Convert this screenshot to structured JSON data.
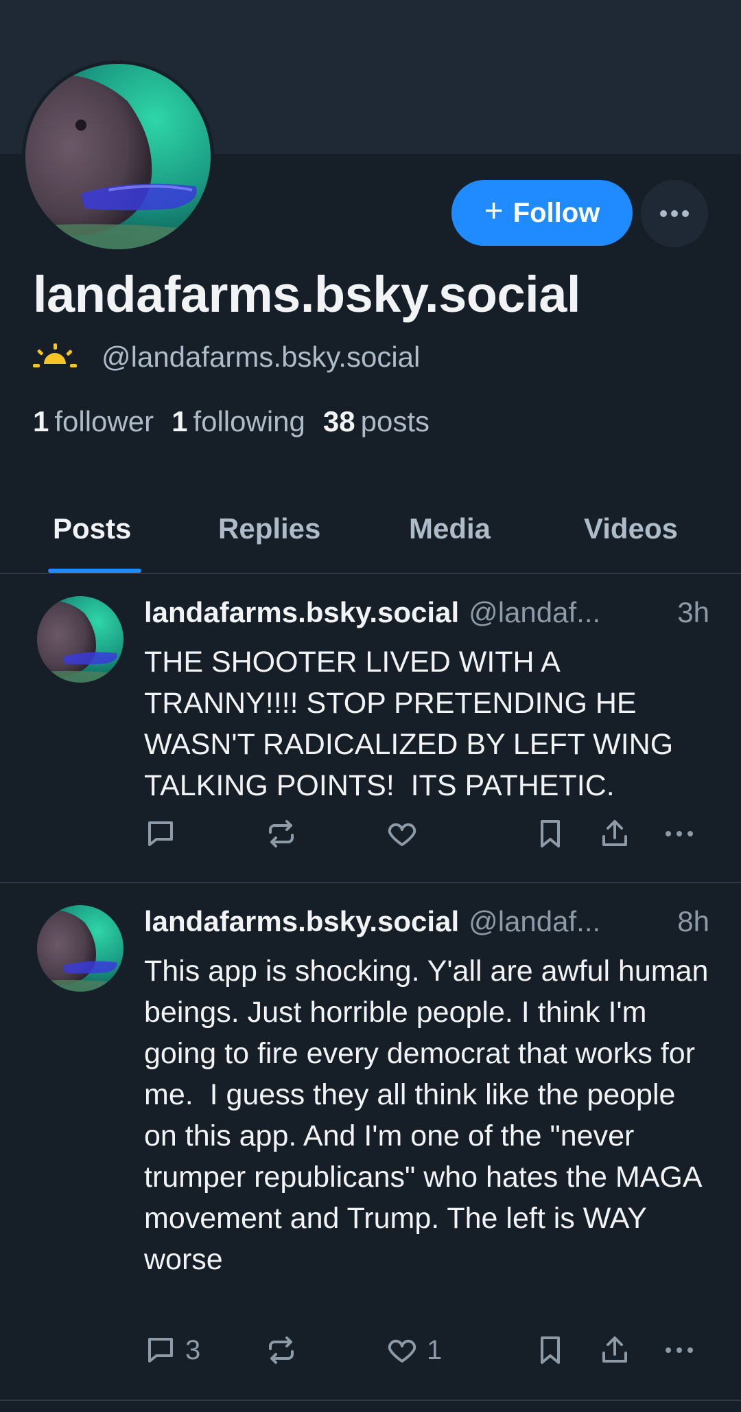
{
  "profile": {
    "display_name": "landafarms.bsky.social",
    "handle": "@landafarms.bsky.social",
    "status_icon": "sun-horizon-icon",
    "accent_color": "#208bfe"
  },
  "actions": {
    "follow_label": "Follow",
    "more_icon": "ellipsis-icon"
  },
  "stats": {
    "followers_count": "1",
    "followers_label": "follower",
    "following_count": "1",
    "following_label": "following",
    "posts_count": "38",
    "posts_label": "posts"
  },
  "tabs": [
    {
      "label": "Posts",
      "active": true
    },
    {
      "label": "Replies",
      "active": false
    },
    {
      "label": "Media",
      "active": false
    },
    {
      "label": "Videos",
      "active": false
    }
  ],
  "posts": [
    {
      "author": "landafarms.bsky.social",
      "handle": "@landaf...",
      "time": "3h",
      "text": "THE SHOOTER LIVED WITH A TRANNY!!!! STOP PRETENDING HE WASN'T RADICALIZED BY LEFT WING TALKING POINTS!  ITS PATHETIC.",
      "reply_count": "",
      "like_count": ""
    },
    {
      "author": "landafarms.bsky.social",
      "handle": "@landaf...",
      "time": "8h",
      "text": "This app is shocking. Y'all are awful human beings. Just horrible people. I think I'm going to fire every democrat that works for me.  I guess they all think like the people on this app. And I'm one of the \"never trumper republicans\" who hates the MAGA movement and Trump. The left is WAY worse",
      "reply_count": "3",
      "like_count": "1"
    }
  ]
}
